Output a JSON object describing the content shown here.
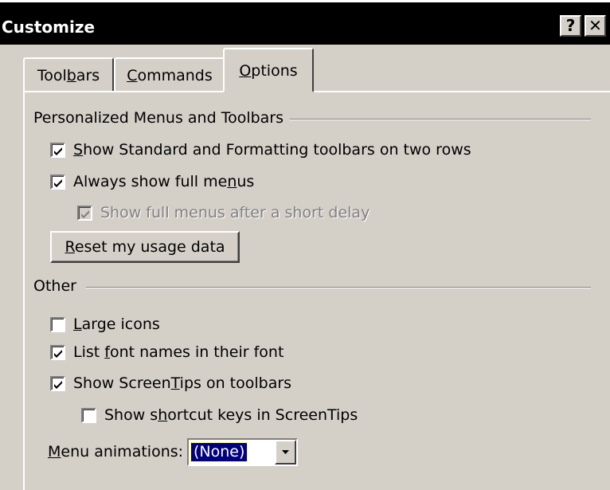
{
  "window": {
    "title": "Customize",
    "help_label": "?",
    "close_label": "✕"
  },
  "tabs": [
    {
      "pre": "Tool",
      "key": "b",
      "post": "ars",
      "active": false
    },
    {
      "pre": "",
      "key": "C",
      "post": "ommands",
      "active": false
    },
    {
      "pre": "",
      "key": "O",
      "post": "ptions",
      "active": true
    }
  ],
  "personalized": {
    "heading": "Personalized Menus and Toolbars",
    "two_rows": {
      "pre": "",
      "key": "S",
      "post": "how Standard and Formatting toolbars on two rows",
      "checked": true,
      "enabled": true
    },
    "full_menus": {
      "pre": "Always show full me",
      "key": "n",
      "post": "us",
      "checked": true,
      "enabled": true
    },
    "short_delay": {
      "pre": "Show full menus after a short delay",
      "key": "",
      "post": "",
      "checked": true,
      "enabled": false
    },
    "reset_button": {
      "pre": "",
      "key": "R",
      "post": "eset my usage data"
    }
  },
  "other": {
    "heading": "Other",
    "large_icons": {
      "pre": "",
      "key": "L",
      "post": "arge icons",
      "checked": false,
      "enabled": true
    },
    "font_names": {
      "pre": "List ",
      "key": "f",
      "post": "ont names in their font",
      "checked": true,
      "enabled": true
    },
    "screentips": {
      "pre": "Show Screen",
      "key": "T",
      "post": "ips on toolbars",
      "checked": true,
      "enabled": true
    },
    "shortcut_keys": {
      "pre": "Show s",
      "key": "h",
      "post": "ortcut keys in ScreenTips",
      "checked": false,
      "enabled": true
    },
    "menu_animations": {
      "label_pre": "",
      "label_key": "M",
      "label_post": "enu animations:",
      "value": "(None)"
    }
  },
  "colors": {
    "face": "#d4d0c8",
    "titlebar": "#000000",
    "selection": "#000080"
  }
}
